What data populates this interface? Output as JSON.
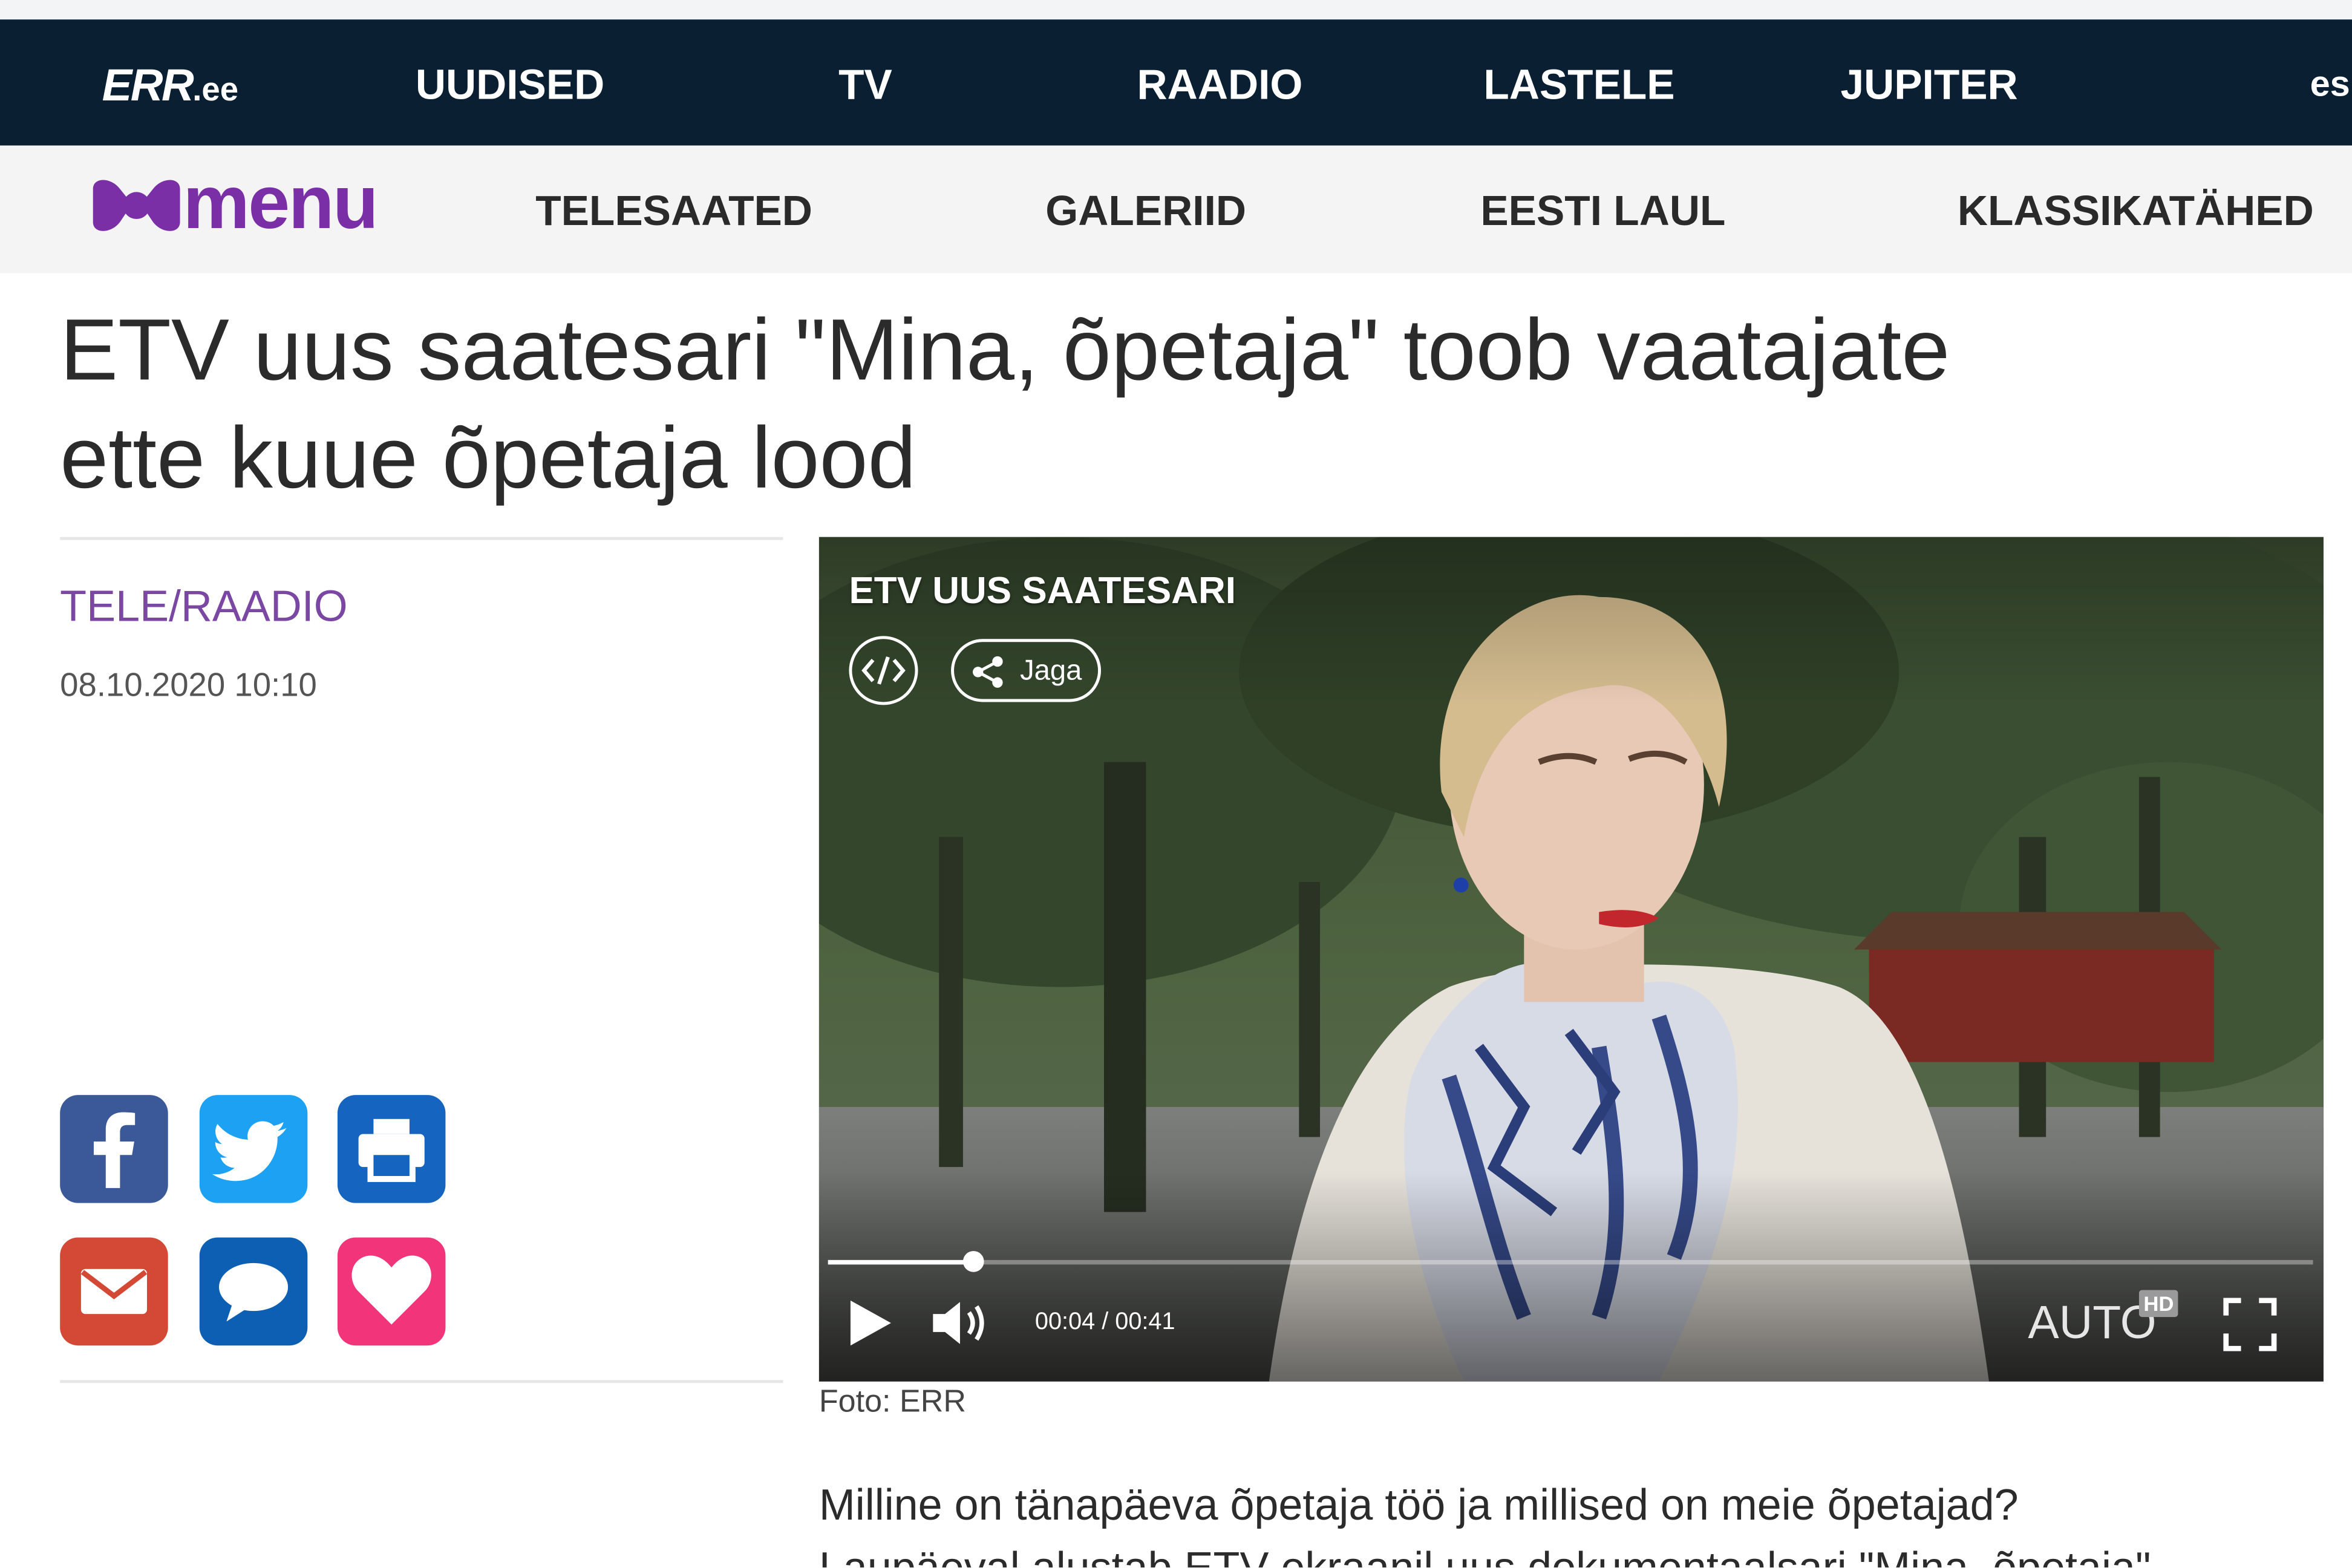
{
  "top_nav": {
    "logo": "ERR",
    "logo_suffix": ".ee",
    "items": [
      "UUDISED",
      "TV",
      "RAADIO",
      "LASTELE",
      "JUPITER"
    ],
    "cutoff_item": "es"
  },
  "sub_nav": {
    "logo": "menu",
    "items": [
      "TELESAATED",
      "GALERIID",
      "EESTI LAUL",
      "KLASSIKATÄHED"
    ]
  },
  "article": {
    "title_line1": "ETV uus saatesari \"Mina, õpetaja\" toob vaatajate",
    "title_line2": "ette kuue õpetaja lood",
    "category": "TELE/RAADIO",
    "date": "08.10.2020 10:10",
    "lead_line1": "Milline on tänapäeva õpetaja töö ja millised on meie õpetajad?",
    "lead_line2": "Laupäeval alustab ETV ekraanil uus dokumentaalsari \"Mina, õpetaja\""
  },
  "share_icons": [
    {
      "name": "facebook-icon",
      "color": "#3b5998"
    },
    {
      "name": "twitter-icon",
      "color": "#1da1f2"
    },
    {
      "name": "print-icon",
      "color": "#1565c0"
    },
    {
      "name": "email-icon",
      "color": "#d44836"
    },
    {
      "name": "comment-icon",
      "color": "#0d5fb3"
    },
    {
      "name": "heart-icon",
      "color": "#f2357a"
    }
  ],
  "video": {
    "label": "ETV UUS SAATESARI",
    "share_label": "Jaga",
    "time": "00:04 / 00:41",
    "progress": 0.0976,
    "quality": "AUTO",
    "hd_badge": "HD",
    "caption": "Foto: ERR"
  },
  "colors": {
    "top_nav_bg": "#0b1f33",
    "sub_nav_bg": "#f4f4f4",
    "menu_purple": "#7b2fa6",
    "category_purple": "#7a47a3"
  }
}
